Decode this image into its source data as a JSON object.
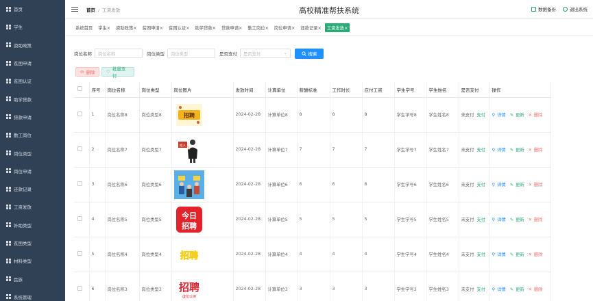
{
  "sidebar": {
    "items": [
      {
        "label": "首页"
      },
      {
        "label": "学生"
      },
      {
        "label": "资助政策"
      },
      {
        "label": "贫困申请"
      },
      {
        "label": "贫困认证"
      },
      {
        "label": "助学贷款"
      },
      {
        "label": "贷款申请"
      },
      {
        "label": "勤工岗位"
      },
      {
        "label": "岗位类型"
      },
      {
        "label": "岗位申请"
      },
      {
        "label": "还款记录"
      },
      {
        "label": "工资发放"
      },
      {
        "label": "补助类型"
      },
      {
        "label": "贫困类型"
      },
      {
        "label": "材料类型"
      },
      {
        "label": "民族"
      },
      {
        "label": "系统管理"
      }
    ]
  },
  "header": {
    "home": "首页",
    "current": "工资发放",
    "title": "高校精准帮扶系统",
    "backup": "数据备份",
    "logout": "退出系统"
  },
  "tags": [
    {
      "label": "系统首页",
      "active": false
    },
    {
      "label": "学生",
      "active": false
    },
    {
      "label": "资助政策",
      "active": false
    },
    {
      "label": "贫困申请",
      "active": false
    },
    {
      "label": "贫困认证",
      "active": false
    },
    {
      "label": "助学贷款",
      "active": false
    },
    {
      "label": "贷款申请",
      "active": false
    },
    {
      "label": "勤工岗位",
      "active": false
    },
    {
      "label": "岗位申请",
      "active": false
    },
    {
      "label": "还款记录",
      "active": false
    },
    {
      "label": "工资发放",
      "active": true
    }
  ],
  "search": {
    "name_label": "岗位名称",
    "name_placeholder": "岗位名称",
    "type_label": "岗位类型",
    "type_placeholder": "岗位类型",
    "pay_label": "是否支付",
    "pay_placeholder": "是否支付",
    "button": "搜索"
  },
  "actions": {
    "delete": "删除",
    "batch_pay": "批量支付"
  },
  "columns": [
    "序号",
    "岗位名称",
    "岗位类型",
    "岗位图片",
    "发放时间",
    "计算单位",
    "薪酬标准",
    "工作时长",
    "应付工资",
    "学生学号",
    "学生姓名",
    "是否支付",
    "操作"
  ],
  "rows": [
    {
      "index": "1",
      "name": "岗位名称8",
      "type": "岗位类型8",
      "image": "banner",
      "time": "2024-02-28",
      "unit": "计算单位8",
      "standard": "8",
      "hours": "8",
      "wage": "8",
      "sid": "学生学号8",
      "sname": "学生姓名8",
      "paid": "未支付",
      "pay": "支付"
    },
    {
      "index": "2",
      "name": "岗位名称7",
      "type": "岗位类型7",
      "image": "person",
      "time": "2024-02-28",
      "unit": "计算单位7",
      "standard": "7",
      "hours": "7",
      "wage": "7",
      "sid": "学生学号7",
      "sname": "学生姓名7",
      "paid": "未支付",
      "pay": "支付"
    },
    {
      "index": "3",
      "name": "岗位名称6",
      "type": "岗位类型6",
      "image": "people",
      "time": "2024-02-28",
      "unit": "计算单位6",
      "standard": "6",
      "hours": "6",
      "wage": "6",
      "sid": "学生学号6",
      "sname": "学生姓名6",
      "paid": "未支付",
      "pay": "支付"
    },
    {
      "index": "4",
      "name": "岗位名称5",
      "type": "岗位类型5",
      "image": "jinri",
      "time": "2024-02-28",
      "unit": "计算单位5",
      "standard": "5",
      "hours": "5",
      "wage": "5",
      "sid": "学生学号5",
      "sname": "学生姓名5",
      "paid": "未支付",
      "pay": "支付"
    },
    {
      "index": "5",
      "name": "岗位名称4",
      "type": "岗位类型4",
      "image": "zhaopin-yellow",
      "time": "2024-02-28",
      "unit": "计算单位4",
      "standard": "4",
      "hours": "4",
      "wage": "4",
      "sid": "学生学号4",
      "sname": "学生姓名4",
      "paid": "未支付",
      "pay": "支付"
    },
    {
      "index": "6",
      "name": "岗位名称3",
      "type": "岗位类型3",
      "image": "zhaopin-red",
      "time": "2024-02-28",
      "unit": "计算单位3",
      "standard": "3",
      "hours": "3",
      "wage": "3",
      "sid": "学生学号3",
      "sname": "学生姓名3",
      "paid": "未支付",
      "pay": "支付"
    }
  ],
  "ops": {
    "detail": "详情",
    "update": "更新",
    "delete": "删除"
  },
  "images": {
    "banner_text": "招聘",
    "jinri_top": "今日",
    "jinri_bottom": "招聘",
    "zhaopin_yellow": "招聘",
    "zhaopin_red": "招聘",
    "zhaopin_red_sub": "虚位以待",
    "person_sign": "招人"
  }
}
